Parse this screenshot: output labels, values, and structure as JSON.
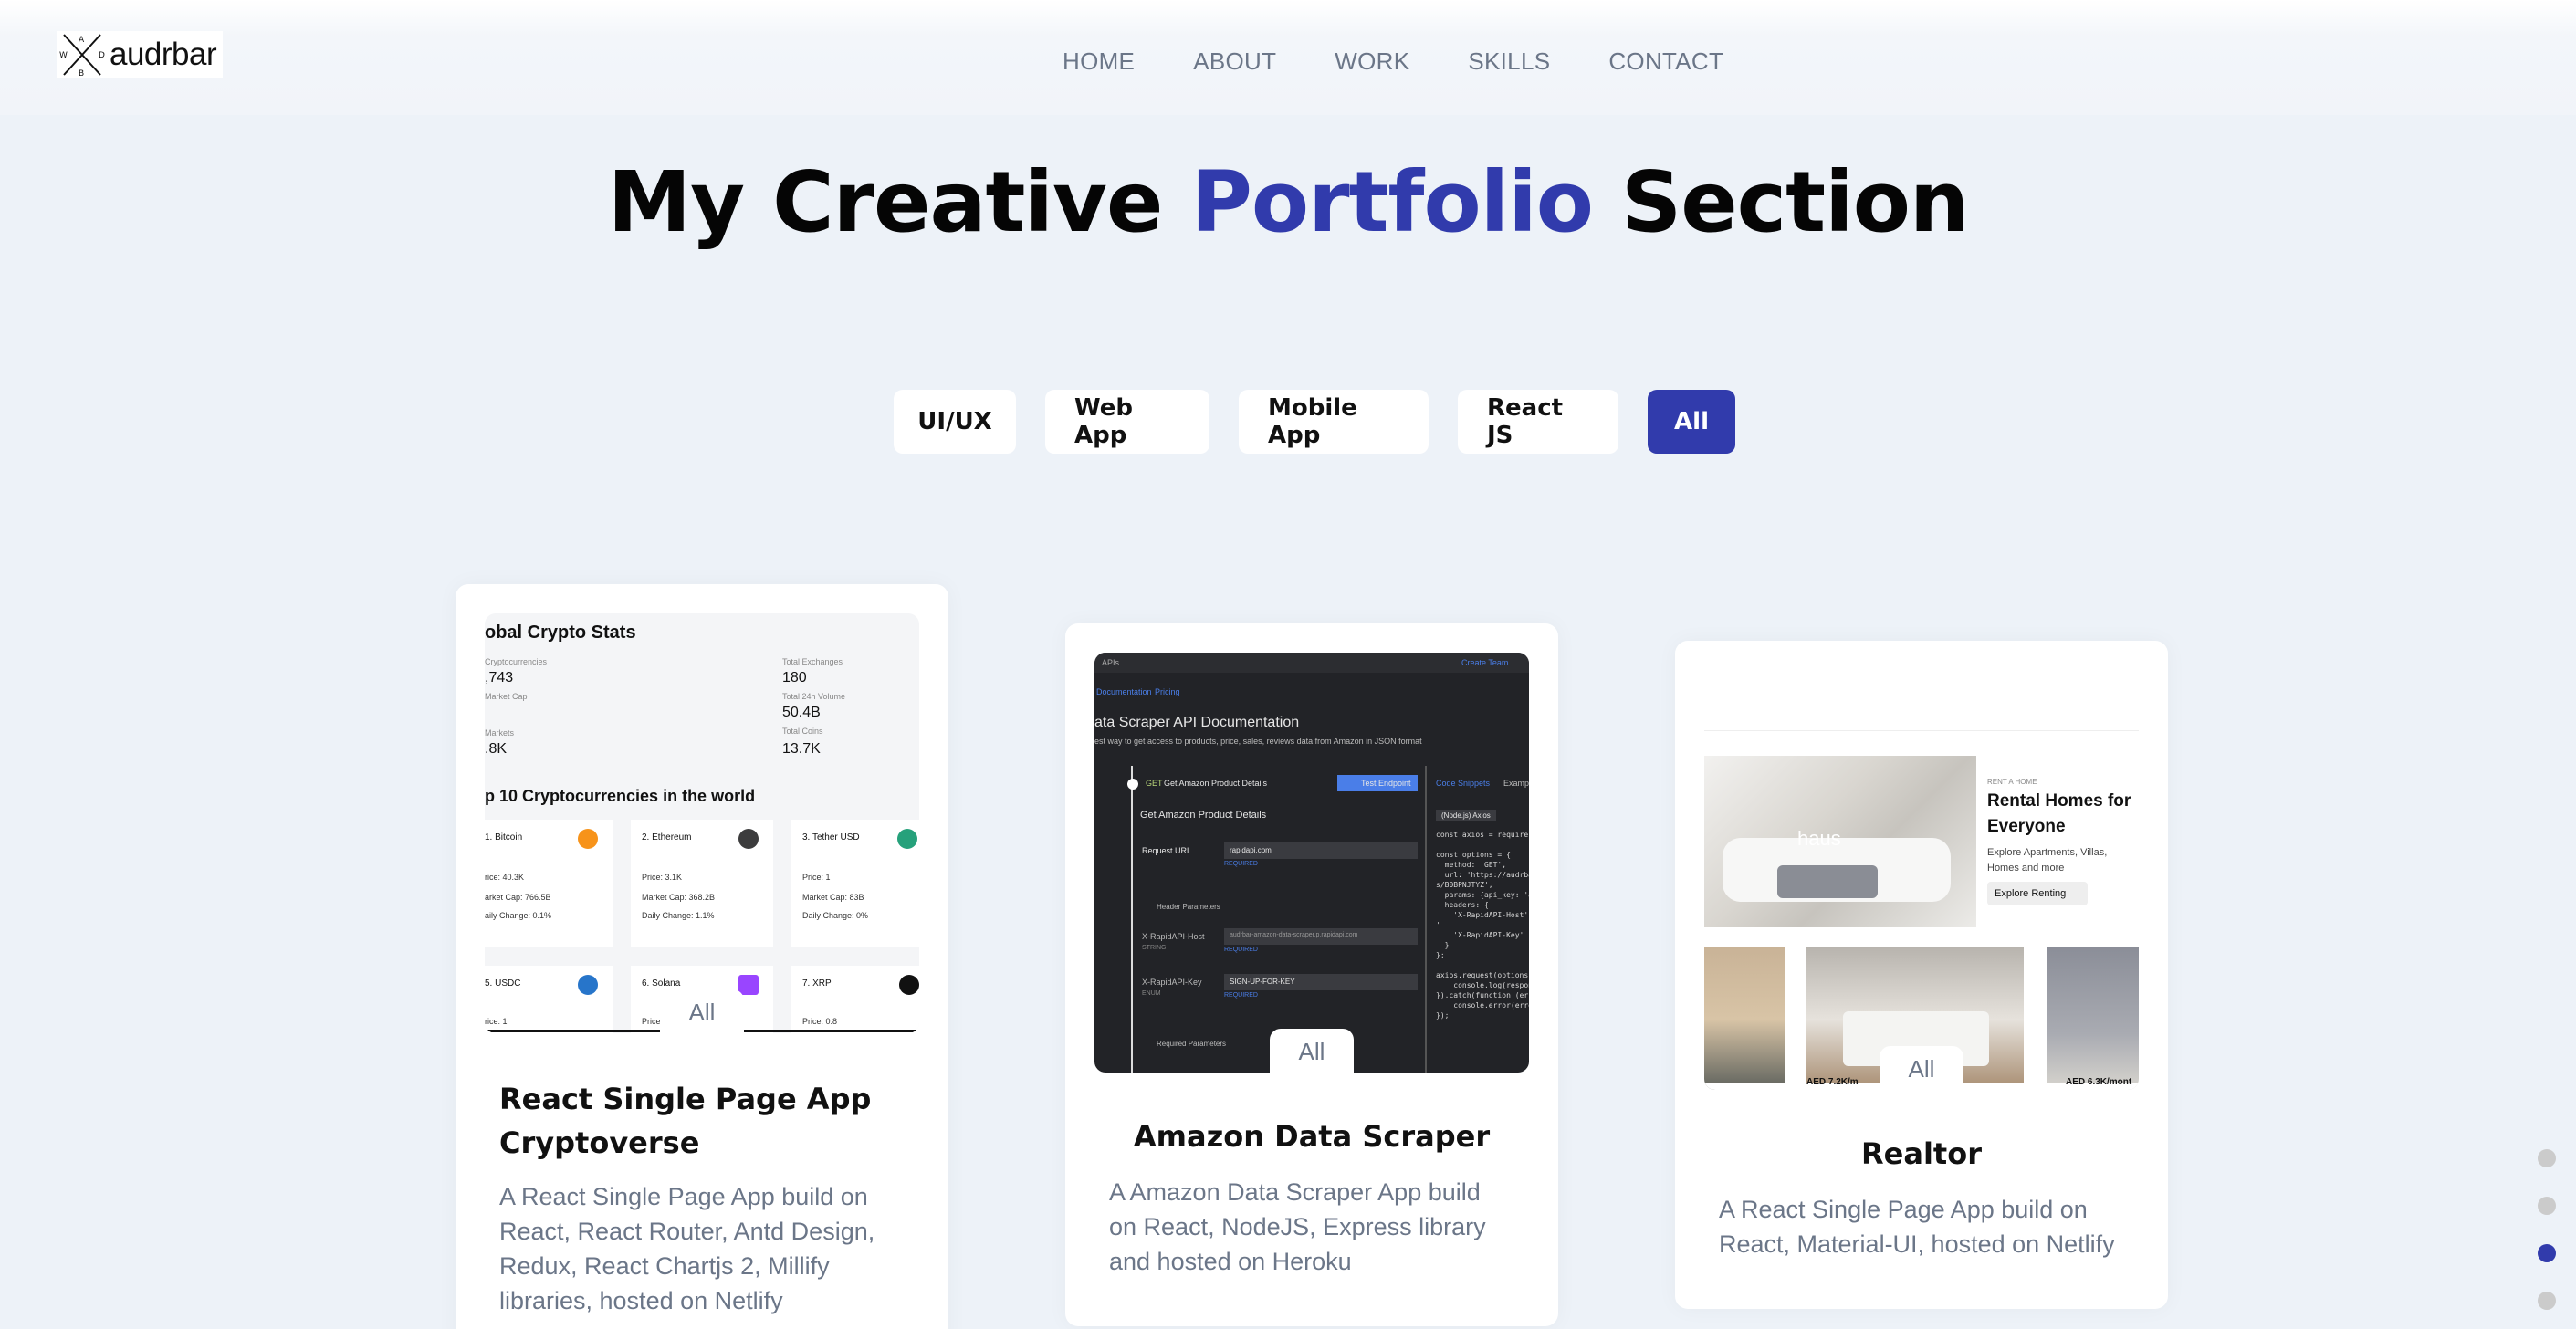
{
  "brand": {
    "name": "audrbar",
    "mark_letters": [
      "A",
      "W",
      "D",
      "B"
    ]
  },
  "nav": {
    "items": [
      "Home",
      "About",
      "Work",
      "Skills",
      "Contact"
    ]
  },
  "headline": {
    "part1": "My Creative",
    "accent": "Portfolio",
    "part2": "Section"
  },
  "filters": {
    "items": [
      "UI/UX",
      "Web App",
      "Mobile App",
      "React JS",
      "All"
    ],
    "active": "All"
  },
  "projects": [
    {
      "title": "React Single Page App Cryptoverse",
      "description": "A React Single Page App build on React, React Router, Antd Design, Redux, React Chartjs 2, Millify libraries, hosted on Netlify",
      "tag": "All",
      "preview": {
        "heading": "obal Crypto Stats",
        "stats_left": [
          {
            "label": "Cryptocurrencies",
            "value": ",743"
          },
          {
            "label": "Market Cap",
            "value": ""
          },
          {
            "label": "Markets",
            "value": ".8K"
          }
        ],
        "stats_right": [
          {
            "label": "Total Exchanges",
            "value": "180"
          },
          {
            "label": "Total 24h Volume",
            "value": "50.4B"
          },
          {
            "label": "Total Coins",
            "value": "13.7K"
          }
        ],
        "subheading": "p 10 Cryptocurrencies in the world",
        "coins": [
          {
            "name": "1. Bitcoin",
            "price": "rice: 40.3K",
            "cap": "arket Cap: 766.5B",
            "change": "aily Change: 0.1%",
            "color": "#f7931a"
          },
          {
            "name": "2. Ethereum",
            "price": "Price: 3.1K",
            "cap": "Market Cap: 368.2B",
            "change": "Daily Change: 1.1%",
            "color": "#3c3c3d"
          },
          {
            "name": "3. Tether USD",
            "price": "Price: 1",
            "cap": "Market Cap: 83B",
            "change": "Daily Change: 0%",
            "color": "#26a17b"
          },
          {
            "name": "5. USDC",
            "price": "rice: 1",
            "cap": "",
            "change": "",
            "color": "#2775ca"
          },
          {
            "name": "6. Solana",
            "price": "Price",
            "cap": "",
            "change": "",
            "color": "#9945ff"
          },
          {
            "name": "7. XRP",
            "price": "Price: 0.8",
            "cap": "",
            "change": "",
            "color": "#111111"
          }
        ]
      }
    },
    {
      "title": "Amazon Data Scraper",
      "description": "A Amazon Data Scraper App build on React, NodeJS, Express library and hosted on Heroku",
      "tag": "All",
      "preview": {
        "top_left": "APIs",
        "top_right": "Create Team",
        "tabs": [
          "Documentation",
          "Pricing"
        ],
        "heading": "ata Scraper API Documentation",
        "sub": "est way to get access to products, price, sales, reviews data from Amazon in JSON format",
        "endpoint_method": "GET",
        "endpoint": "Get Amazon Product Details",
        "test_button": "Test Endpoint",
        "panel_title": "Get Amazon Product Details",
        "code_tabs": [
          "Code Snippets",
          "Examp"
        ],
        "lang": "(Node.js) Axios",
        "fields": [
          {
            "label": "Request URL",
            "value": "rapidapi.com",
            "req": "REQUIRED"
          },
          {
            "label": "Header Parameters",
            "value": "",
            "req": ""
          },
          {
            "label": "X-RapidAPI-Host",
            "sub": "STRING",
            "value": "audrbar-amazon-data-scraper.p.rapidapi.com",
            "req": "REQUIRED"
          },
          {
            "label": "X-RapidAPI-Key",
            "sub": "ENUM",
            "value": "SIGN-UP-FOR-KEY",
            "req": "REQUIRED"
          },
          {
            "label": "Required Parameters",
            "value": "",
            "req": ""
          }
        ],
        "code": "const axios = require(\"\n\nconst options = {\n  method: 'GET',\n  url: 'https://audrba\ns/B0BPNJTYZ',\n  params: {api_key: 'a\n  headers: {\n    'X-RapidAPI-Host'\n'\n    'X-RapidAPI-Key'\n  }\n};\n\naxios.request(options)\n    console.log(respon\n}).catch(function (erro\n    console.error(erro\n});"
      }
    },
    {
      "title": "Realtor",
      "description": "A React Single Page App build on React, Material-UI, hosted on Netlify",
      "tag": "All",
      "preview": {
        "kicker": "RENT A HOME",
        "heading": "Rental Homes for Everyone",
        "sub": "Explore Apartments, Villas, Homes and more",
        "button": "Explore Renting",
        "brand_watermark": "haus",
        "prices": [
          "AED 7.2K/m",
          "AED 6.3K/mont"
        ]
      }
    }
  ],
  "colors": {
    "accent": "#313bac",
    "background": "#edf2f8",
    "muted_text": "#6b7688"
  },
  "section_dots": {
    "count": 4,
    "active_index": 2
  }
}
